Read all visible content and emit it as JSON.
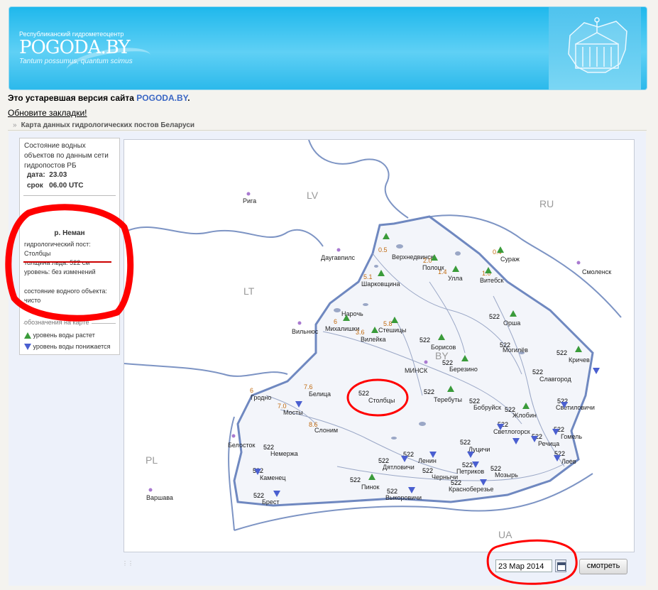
{
  "header": {
    "tagline": "Республиканский гидрометеоцентр",
    "logo": "POGODA.BY",
    "motto": "Tantum possumus, quantum scimus"
  },
  "notice": {
    "text": "Это устаревшая версия сайта ",
    "link": "POGODA.BY",
    "tail": ".",
    "bookmark": "Обновите закладки!"
  },
  "section": {
    "title": "Карта данных гидрологических постов Беларуси"
  },
  "legend": {
    "line1": "Состояние водных объектов по данным сети гидропостов РБ",
    "date_label": "дата:",
    "date_value": "23.03",
    "term_label": "срок",
    "term_value": "06.00 UTC",
    "river": "р. Неман",
    "post_label": "гидрологический пост:",
    "post_name": "Столбцы",
    "ice": "толщина льда: 522 см",
    "level": "уровень: без изменений",
    "state": "состояние водного объекта: чисто",
    "legend_title": "обозначения на карте",
    "rise": "уровень воды растет",
    "fall": "уровень воды понижается",
    "colors": {
      "rise": "#3a9b3a",
      "fall": "#4a5fd0",
      "annotation": "#ff0000"
    }
  },
  "map": {
    "countries": [
      "LV",
      "RU",
      "LT",
      "BY",
      "PL",
      "UA"
    ],
    "cities": [
      "Рига",
      "Даугавпилс",
      "Вильнюс",
      "Смоленск",
      "Белосток",
      "Варшава",
      "МИНСК"
    ],
    "stations": [
      {
        "name": "Верхнедвинск",
        "value": "0.5"
      },
      {
        "name": "Полоцк",
        "value": "2.0"
      },
      {
        "name": "Сураж",
        "value": "0.4"
      },
      {
        "name": "Улла",
        "value": "1.4"
      },
      {
        "name": "Витебск",
        "value": "1.0"
      },
      {
        "name": "Шарковщина",
        "value": "5.1"
      },
      {
        "name": "Нарочь",
        "value": ""
      },
      {
        "name": "Михалишки",
        "value": "6"
      },
      {
        "name": "Стешицы",
        "value": "5.8"
      },
      {
        "name": "Вилейка",
        "value": "3.6"
      },
      {
        "name": "Орша",
        "value": "522"
      },
      {
        "name": "Могилёв",
        "value": "522"
      },
      {
        "name": "Кричев",
        "value": "522"
      },
      {
        "name": "Борисов",
        "value": "522"
      },
      {
        "name": "Березино",
        "value": "522"
      },
      {
        "name": "Славгород",
        "value": "522"
      },
      {
        "name": "Гродно",
        "value": "6"
      },
      {
        "name": "Белица",
        "value": "7.6"
      },
      {
        "name": "Мосты",
        "value": "7.0"
      },
      {
        "name": "Столбцы",
        "value": "522"
      },
      {
        "name": "Теребуты",
        "value": "522"
      },
      {
        "name": "Бобруйск",
        "value": "522"
      },
      {
        "name": "Жлобин",
        "value": "522"
      },
      {
        "name": "Светиловичи",
        "value": "522"
      },
      {
        "name": "Слоним",
        "value": "8.6"
      },
      {
        "name": "Светлогорск",
        "value": "522"
      },
      {
        "name": "Гомель",
        "value": "522"
      },
      {
        "name": "Речица",
        "value": "522"
      },
      {
        "name": "Лоев",
        "value": "522"
      },
      {
        "name": "Немержа",
        "value": "522"
      },
      {
        "name": "Луцичи",
        "value": "522"
      },
      {
        "name": "Ленин",
        "value": "522"
      },
      {
        "name": "Дятловичи",
        "value": "522"
      },
      {
        "name": "Каменец",
        "value": "522"
      },
      {
        "name": "Петриков",
        "value": "522"
      },
      {
        "name": "Чернычи",
        "value": "522"
      },
      {
        "name": "Мозырь",
        "value": "522"
      },
      {
        "name": "Пинок",
        "value": "522"
      },
      {
        "name": "Брест",
        "value": "522"
      },
      {
        "name": "Выкоровичи",
        "value": "522"
      },
      {
        "name": "Красноберезье",
        "value": "522"
      }
    ]
  },
  "controls": {
    "date": "23 Мар 2014",
    "show_button": "смотреть"
  }
}
